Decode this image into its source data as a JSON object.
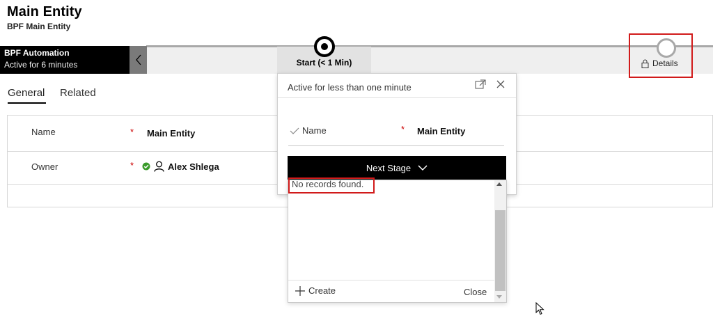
{
  "header": {
    "title": "Main Entity",
    "subtitle": "BPF Main Entity"
  },
  "bpf": {
    "process_name": "BPF Automation",
    "process_status": "Active for 6 minutes",
    "active_stage_label": "Start  (< 1 Min)",
    "details_label": "Details"
  },
  "tabs": [
    {
      "label": "General",
      "selected": true
    },
    {
      "label": "Related",
      "selected": false
    }
  ],
  "form": {
    "fields": [
      {
        "label": "Name",
        "required_marker": "*",
        "value": "Main Entity"
      },
      {
        "label": "Owner",
        "required_marker": "*",
        "value": "Alex Shlega"
      }
    ]
  },
  "stage_flyout": {
    "status": "Active for less than one minute",
    "field_label": "Name",
    "field_required_marker": "*",
    "field_value": "Main Entity",
    "next_stage_label": "Next Stage"
  },
  "lookup_dropdown": {
    "empty_message": "No records found.",
    "create_label": "Create",
    "close_label": "Close"
  },
  "colors": {
    "highlight_border": "#d11a1a",
    "bpf_flyout_bg": "#000000",
    "owner_status_green": "#3a9b2b",
    "required_red": "#cc0000"
  }
}
